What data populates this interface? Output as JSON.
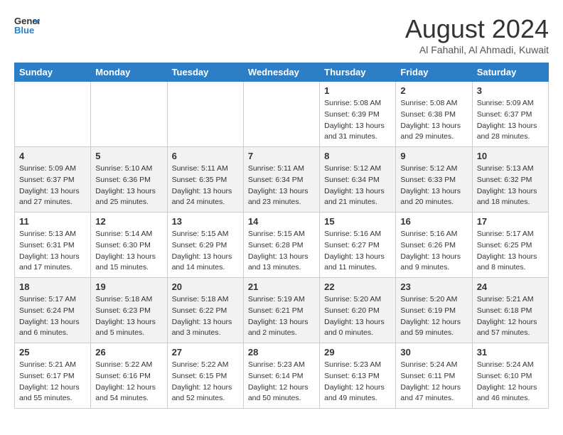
{
  "header": {
    "month": "August 2024",
    "location": "Al Fahahil, Al Ahmadi, Kuwait",
    "logo_line1": "General",
    "logo_line2": "Blue"
  },
  "days_of_week": [
    "Sunday",
    "Monday",
    "Tuesday",
    "Wednesday",
    "Thursday",
    "Friday",
    "Saturday"
  ],
  "weeks": [
    [
      {
        "num": "",
        "info": ""
      },
      {
        "num": "",
        "info": ""
      },
      {
        "num": "",
        "info": ""
      },
      {
        "num": "",
        "info": ""
      },
      {
        "num": "1",
        "info": "Sunrise: 5:08 AM\nSunset: 6:39 PM\nDaylight: 13 hours\nand 31 minutes."
      },
      {
        "num": "2",
        "info": "Sunrise: 5:08 AM\nSunset: 6:38 PM\nDaylight: 13 hours\nand 29 minutes."
      },
      {
        "num": "3",
        "info": "Sunrise: 5:09 AM\nSunset: 6:37 PM\nDaylight: 13 hours\nand 28 minutes."
      }
    ],
    [
      {
        "num": "4",
        "info": "Sunrise: 5:09 AM\nSunset: 6:37 PM\nDaylight: 13 hours\nand 27 minutes."
      },
      {
        "num": "5",
        "info": "Sunrise: 5:10 AM\nSunset: 6:36 PM\nDaylight: 13 hours\nand 25 minutes."
      },
      {
        "num": "6",
        "info": "Sunrise: 5:11 AM\nSunset: 6:35 PM\nDaylight: 13 hours\nand 24 minutes."
      },
      {
        "num": "7",
        "info": "Sunrise: 5:11 AM\nSunset: 6:34 PM\nDaylight: 13 hours\nand 23 minutes."
      },
      {
        "num": "8",
        "info": "Sunrise: 5:12 AM\nSunset: 6:34 PM\nDaylight: 13 hours\nand 21 minutes."
      },
      {
        "num": "9",
        "info": "Sunrise: 5:12 AM\nSunset: 6:33 PM\nDaylight: 13 hours\nand 20 minutes."
      },
      {
        "num": "10",
        "info": "Sunrise: 5:13 AM\nSunset: 6:32 PM\nDaylight: 13 hours\nand 18 minutes."
      }
    ],
    [
      {
        "num": "11",
        "info": "Sunrise: 5:13 AM\nSunset: 6:31 PM\nDaylight: 13 hours\nand 17 minutes."
      },
      {
        "num": "12",
        "info": "Sunrise: 5:14 AM\nSunset: 6:30 PM\nDaylight: 13 hours\nand 15 minutes."
      },
      {
        "num": "13",
        "info": "Sunrise: 5:15 AM\nSunset: 6:29 PM\nDaylight: 13 hours\nand 14 minutes."
      },
      {
        "num": "14",
        "info": "Sunrise: 5:15 AM\nSunset: 6:28 PM\nDaylight: 13 hours\nand 13 minutes."
      },
      {
        "num": "15",
        "info": "Sunrise: 5:16 AM\nSunset: 6:27 PM\nDaylight: 13 hours\nand 11 minutes."
      },
      {
        "num": "16",
        "info": "Sunrise: 5:16 AM\nSunset: 6:26 PM\nDaylight: 13 hours\nand 9 minutes."
      },
      {
        "num": "17",
        "info": "Sunrise: 5:17 AM\nSunset: 6:25 PM\nDaylight: 13 hours\nand 8 minutes."
      }
    ],
    [
      {
        "num": "18",
        "info": "Sunrise: 5:17 AM\nSunset: 6:24 PM\nDaylight: 13 hours\nand 6 minutes."
      },
      {
        "num": "19",
        "info": "Sunrise: 5:18 AM\nSunset: 6:23 PM\nDaylight: 13 hours\nand 5 minutes."
      },
      {
        "num": "20",
        "info": "Sunrise: 5:18 AM\nSunset: 6:22 PM\nDaylight: 13 hours\nand 3 minutes."
      },
      {
        "num": "21",
        "info": "Sunrise: 5:19 AM\nSunset: 6:21 PM\nDaylight: 13 hours\nand 2 minutes."
      },
      {
        "num": "22",
        "info": "Sunrise: 5:20 AM\nSunset: 6:20 PM\nDaylight: 13 hours\nand 0 minutes."
      },
      {
        "num": "23",
        "info": "Sunrise: 5:20 AM\nSunset: 6:19 PM\nDaylight: 12 hours\nand 59 minutes."
      },
      {
        "num": "24",
        "info": "Sunrise: 5:21 AM\nSunset: 6:18 PM\nDaylight: 12 hours\nand 57 minutes."
      }
    ],
    [
      {
        "num": "25",
        "info": "Sunrise: 5:21 AM\nSunset: 6:17 PM\nDaylight: 12 hours\nand 55 minutes."
      },
      {
        "num": "26",
        "info": "Sunrise: 5:22 AM\nSunset: 6:16 PM\nDaylight: 12 hours\nand 54 minutes."
      },
      {
        "num": "27",
        "info": "Sunrise: 5:22 AM\nSunset: 6:15 PM\nDaylight: 12 hours\nand 52 minutes."
      },
      {
        "num": "28",
        "info": "Sunrise: 5:23 AM\nSunset: 6:14 PM\nDaylight: 12 hours\nand 50 minutes."
      },
      {
        "num": "29",
        "info": "Sunrise: 5:23 AM\nSunset: 6:13 PM\nDaylight: 12 hours\nand 49 minutes."
      },
      {
        "num": "30",
        "info": "Sunrise: 5:24 AM\nSunset: 6:11 PM\nDaylight: 12 hours\nand 47 minutes."
      },
      {
        "num": "31",
        "info": "Sunrise: 5:24 AM\nSunset: 6:10 PM\nDaylight: 12 hours\nand 46 minutes."
      }
    ]
  ]
}
